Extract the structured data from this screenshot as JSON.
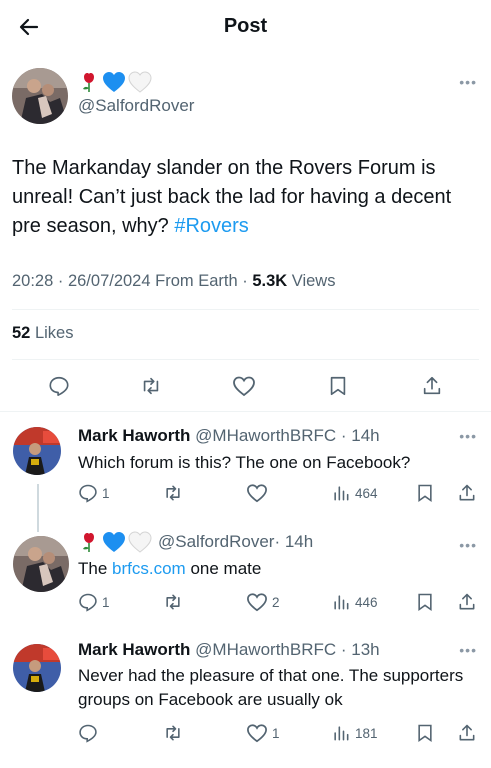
{
  "header": {
    "title": "Post"
  },
  "post": {
    "handle": "@SalfordRover",
    "text": "The Markanday slander on the Rovers Forum is unreal! Can’t just back the lad for having a decent pre season, why? ",
    "hashtag": "#Rovers",
    "timestamp": "20:28 · 26/07/2024 From Earth · ",
    "views_count": "5.3K",
    "views_label": " Views",
    "likes_count": "52",
    "likes_label": " Likes"
  },
  "replies": [
    {
      "name": "Mark Haworth",
      "handle": "@MHaworthBRFC",
      "time": " · 14h",
      "text": "Which forum is this? The one on Facebook?",
      "reply_count": "1",
      "retweet_count": "",
      "like_count": "",
      "views": "464"
    },
    {
      "name": "",
      "handle": "@SalfordRover",
      "time": " · 14h",
      "text_before": "The ",
      "link": "brfcs.com",
      "text_after": " one mate",
      "reply_count": "1",
      "retweet_count": "",
      "like_count": "2",
      "views": "446"
    },
    {
      "name": "Mark Haworth",
      "handle": "@MHaworthBRFC",
      "time": " · 13h",
      "text": "Never had the pleasure of that one. The supporters groups on Facebook are usually ok",
      "reply_count": "",
      "retweet_count": "",
      "like_count": "1",
      "views": "181"
    }
  ],
  "colors": {
    "accent": "#1d9bf0",
    "muted": "#536471",
    "rose": "#d1162e",
    "blue_heart": "#1d8ff0"
  }
}
